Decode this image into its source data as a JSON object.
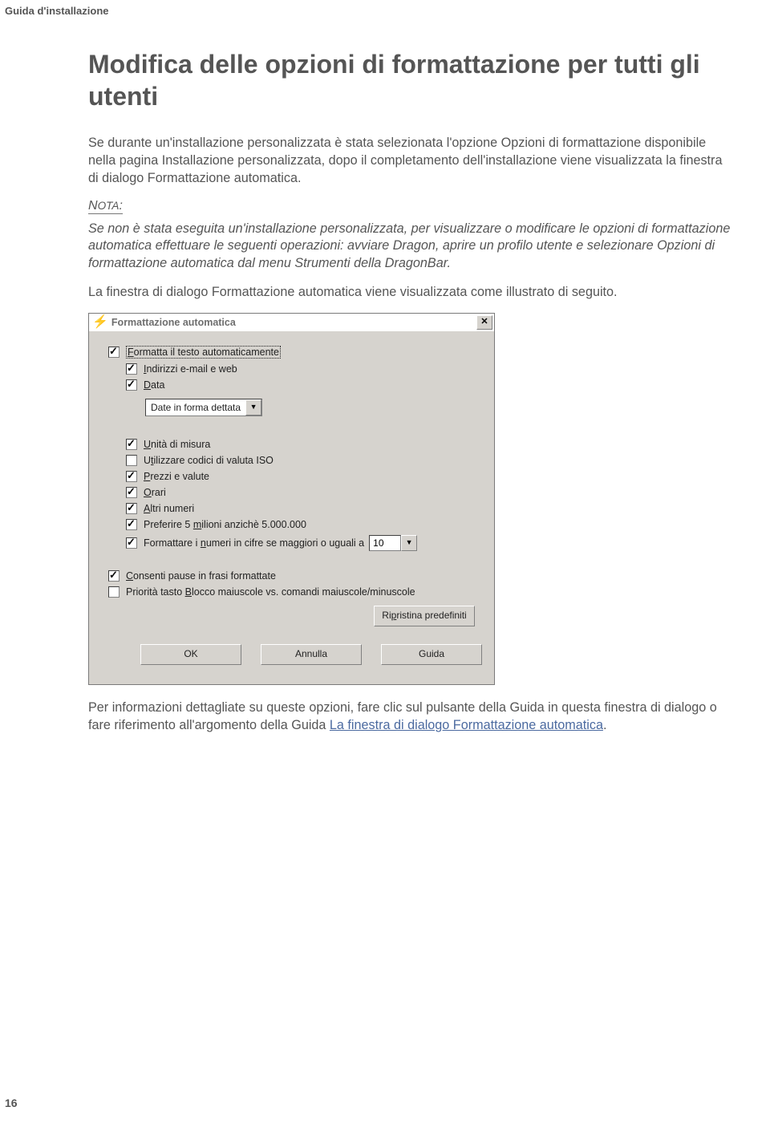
{
  "page": {
    "running_header": "Guida d'installazione",
    "page_number": "16"
  },
  "heading": "Modifica delle opzioni di formattazione per tutti gli utenti",
  "para1": "Se durante un'installazione personalizzata è stata selezionata l'opzione Opzioni di formattazione disponibile nella pagina Installazione personalizzata, dopo il completamento dell'installazione viene visualizzata la finestra di dialogo Formattazione automatica.",
  "nota_label": "NOTA:",
  "note1": "Se non è stata eseguita un'installazione personalizzata, per visualizzare o modificare le opzioni di formattazione automatica effettuare le seguenti operazioni: avviare Dragon, aprire un profilo utente e selezionare Opzioni di formattazione automatica dal menu Strumenti della DragonBar.",
  "para2": "La finestra di dialogo Formattazione automatica viene visualizzata come illustrato di seguito.",
  "para3_pre": "Per informazioni dettagliate su queste opzioni, fare clic sul pulsante della Guida in questa finestra di dialogo o fare riferimento all'argomento della Guida ",
  "para3_link": "La finestra di dialogo Formattazione automatica",
  "para3_post": ".",
  "dialog": {
    "title": "Formattazione automatica",
    "options": {
      "auto_format": "Formatta il testo automaticamente",
      "email_web": "Indirizzi e-mail e web",
      "date": "Data",
      "date_mode": "Date in forma dettata",
      "units": "Unità di misura",
      "iso_currency": "Utilizzare codici di valuta ISO",
      "prices": "Prezzi e valute",
      "times": "Orari",
      "other_numbers": "Altri numeri",
      "prefer_million": "Preferire 5 milioni anzichè 5.000.000",
      "numbers_ge_label": "Formattare i numeri in cifre se maggiori o uguali a",
      "numbers_ge_value": "10",
      "allow_pauses": "Consenti pause in frasi formattate",
      "caps_priority": "Priorità tasto Blocco maiuscole vs. comandi maiuscole/minuscole"
    },
    "buttons": {
      "reset": "Ripristina predefiniti",
      "ok": "OK",
      "cancel": "Annulla",
      "help": "Guida"
    }
  }
}
